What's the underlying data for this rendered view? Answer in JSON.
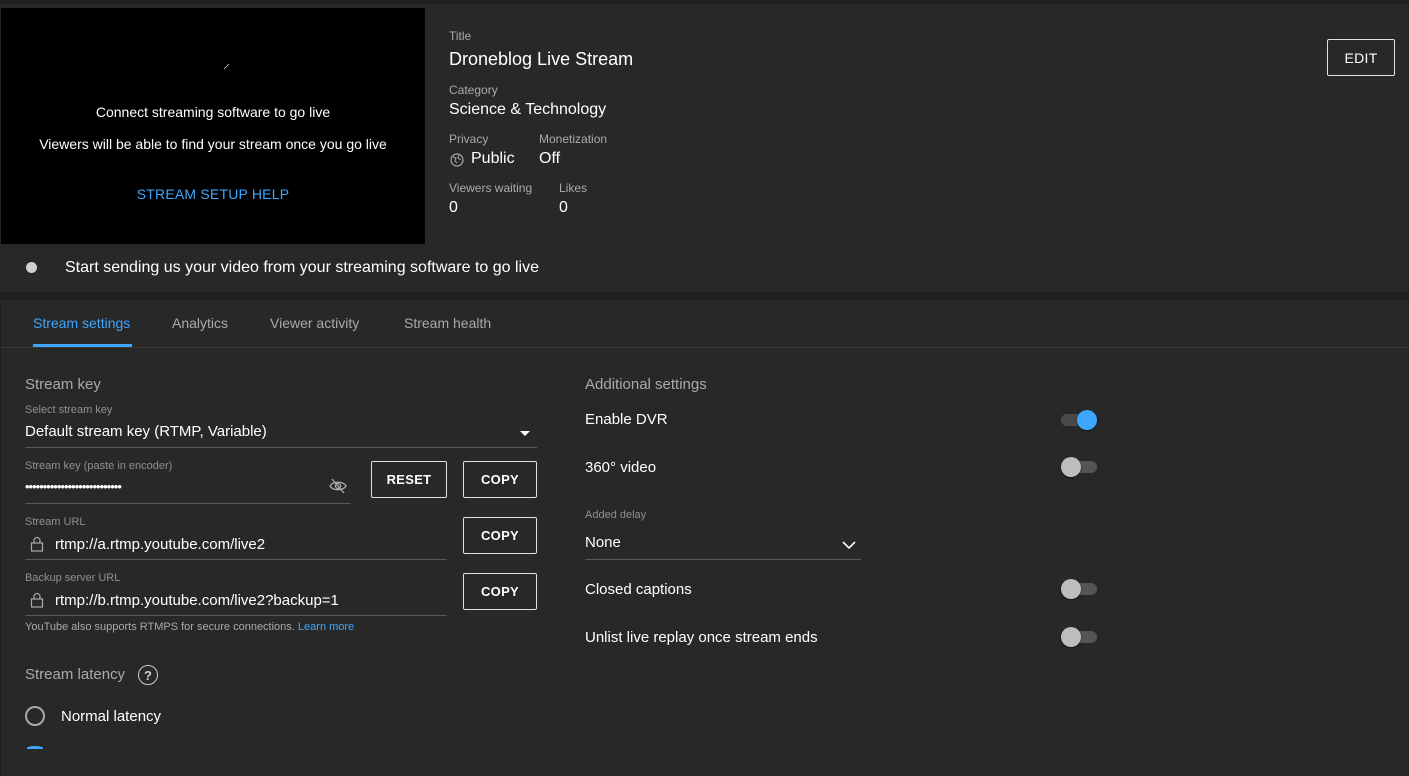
{
  "preview": {
    "spinner": "⸝",
    "line1": "Connect streaming software to go live",
    "line2": "Viewers will be able to find your stream once you go live",
    "help_link": "STREAM SETUP HELP"
  },
  "details": {
    "title_label": "Title",
    "title_value": "Droneblog Live Stream",
    "category_label": "Category",
    "category_value": "Science & Technology",
    "privacy_label": "Privacy",
    "privacy_value": "Public",
    "monetization_label": "Monetization",
    "monetization_value": "Off",
    "viewers_label": "Viewers waiting",
    "viewers_value": "0",
    "likes_label": "Likes",
    "likes_value": "0",
    "edit_label": "EDIT"
  },
  "status": {
    "text": "Start sending us your video from your streaming software to go live"
  },
  "tabs": [
    {
      "label": "Stream settings",
      "active": true
    },
    {
      "label": "Analytics",
      "active": false
    },
    {
      "label": "Viewer activity",
      "active": false
    },
    {
      "label": "Stream health",
      "active": false
    }
  ],
  "stream_key": {
    "section_title": "Stream key",
    "select_label": "Select stream key",
    "select_value": "Default stream key (RTMP, Variable)",
    "key_label": "Stream key (paste in encoder)",
    "key_value": "•••••••••••••••••••••••••••",
    "reset_label": "RESET",
    "copy_label": "COPY",
    "url_label": "Stream URL",
    "url_value": "rtmp://a.rtmp.youtube.com/live2",
    "backup_label": "Backup server URL",
    "backup_value": "rtmp://b.rtmp.youtube.com/live2?backup=1",
    "hint_text": "YouTube also supports RTMPS for secure connections.",
    "hint_link": "Learn more"
  },
  "latency": {
    "section_title": "Stream latency",
    "help_glyph": "?",
    "normal_label": "Normal latency"
  },
  "additional": {
    "section_title": "Additional settings",
    "dvr_label": "Enable DVR",
    "dvr_on": true,
    "video360_label": "360° video",
    "video360_on": false,
    "delay_label": "Added delay",
    "delay_value": "None",
    "captions_label": "Closed captions",
    "captions_on": false,
    "unlist_label": "Unlist live replay once stream ends",
    "unlist_on": false
  },
  "colors": {
    "accent": "#3ea6ff",
    "panel": "#282828",
    "background": "#1f1f1f"
  }
}
